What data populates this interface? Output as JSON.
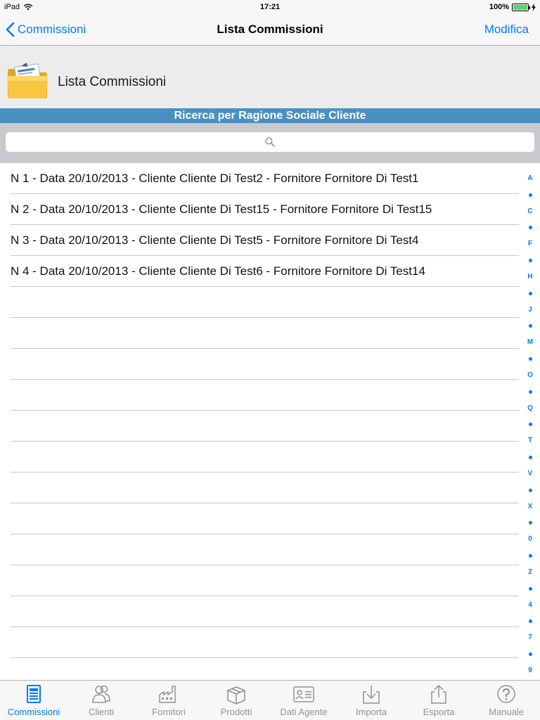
{
  "status": {
    "device": "iPad",
    "time": "17:21",
    "battery": "100%",
    "battery_level": 1.0
  },
  "nav": {
    "back_label": "Commissioni",
    "title": "Lista Commissioni",
    "action_label": "Modifica"
  },
  "header": {
    "title": "Lista Commissioni",
    "icon": "folder-icon"
  },
  "section": {
    "title": "Ricerca per Ragione Sociale Cliente"
  },
  "search": {
    "placeholder": "",
    "value": ""
  },
  "rows": [
    "N 1 - Data 20/10/2013 - Cliente Cliente Di Test2 - Fornitore Fornitore Di Test1",
    "N 2 - Data 20/10/2013 - Cliente Cliente Di Test15 - Fornitore Fornitore Di Test15",
    "N 3 - Data 20/10/2013 - Cliente Cliente Di Test5 - Fornitore Fornitore Di Test4",
    "N 4 - Data 20/10/2013 - Cliente Cliente Di Test6 - Fornitore Fornitore Di Test14",
    "",
    "",
    "",
    "",
    "",
    "",
    "",
    "",
    "",
    "",
    "",
    "",
    ""
  ],
  "index": [
    "A",
    "•",
    "C",
    "•",
    "F",
    "•",
    "H",
    "•",
    "J",
    "•",
    "M",
    "•",
    "O",
    "•",
    "Q",
    "•",
    "T",
    "•",
    "V",
    "•",
    "X",
    "•",
    "0",
    "•",
    "2",
    "•",
    "4",
    "•",
    "7",
    "•",
    "9"
  ],
  "tabs": [
    {
      "label": "Commissioni",
      "icon": "document-icon",
      "active": true
    },
    {
      "label": "Clienti",
      "icon": "people-icon",
      "active": false
    },
    {
      "label": "Fornitori",
      "icon": "factory-icon",
      "active": false
    },
    {
      "label": "Prodotti",
      "icon": "box-icon",
      "active": false
    },
    {
      "label": "Dati Agente",
      "icon": "id-card-icon",
      "active": false
    },
    {
      "label": "Importa",
      "icon": "import-icon",
      "active": false
    },
    {
      "label": "Esporta",
      "icon": "export-icon",
      "active": false
    },
    {
      "label": "Manuale",
      "icon": "help-icon",
      "active": false
    }
  ],
  "colors": {
    "accent": "#007aff",
    "section_bar": "#4a90c0",
    "tab_inactive": "#929292"
  }
}
